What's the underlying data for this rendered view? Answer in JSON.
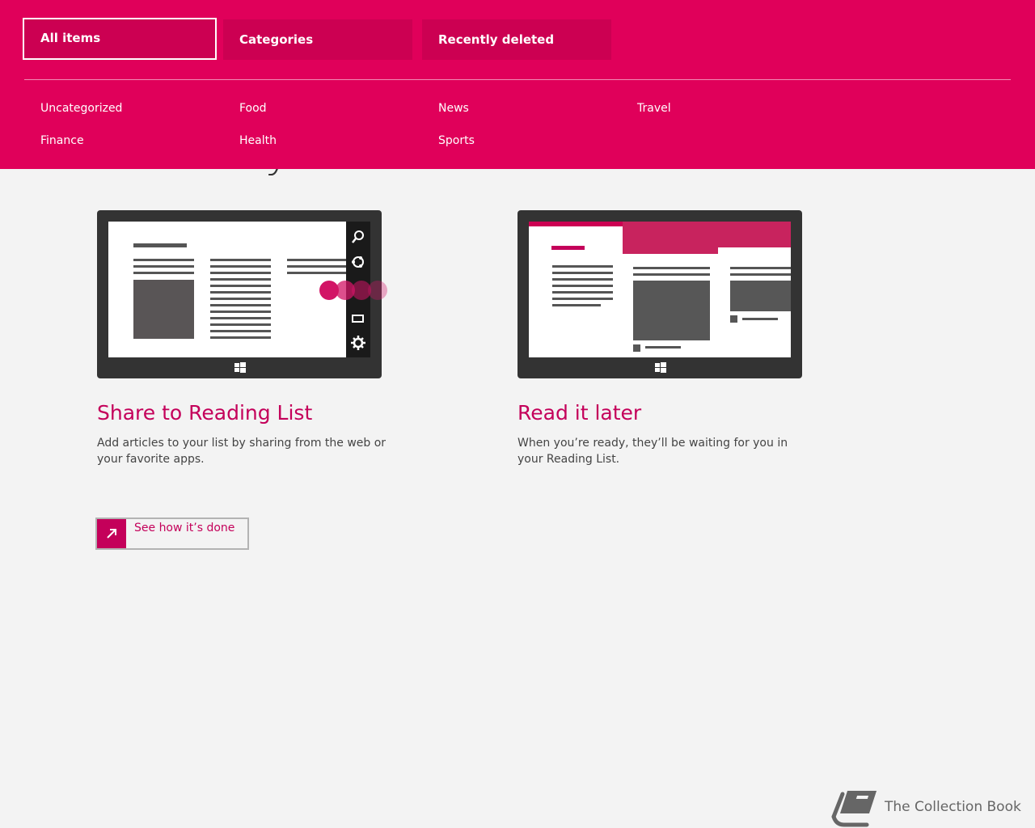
{
  "nav": {
    "tabs": [
      {
        "label": "All items"
      },
      {
        "label": "Categories"
      },
      {
        "label": "Recently deleted"
      }
    ],
    "categories": [
      "Uncategorized",
      "Food",
      "News",
      "Travel",
      "Finance",
      "Health",
      "Sports"
    ]
  },
  "hero": {
    "title": "Read at your leisure"
  },
  "features": [
    {
      "title": "Share to Reading List",
      "text": "Add articles to your list by sharing from the web or your favorite apps."
    },
    {
      "title": "Read it later",
      "text": "When you’re ready, they’ll be waiting for you in your Reading List."
    }
  ],
  "cta": {
    "label": "See how it’s done"
  },
  "footer": {
    "brand": "The Collection Book"
  },
  "colors": {
    "accent": "#e0005a",
    "accent_dark": "#c4005a",
    "background": "#f3f3f3"
  }
}
